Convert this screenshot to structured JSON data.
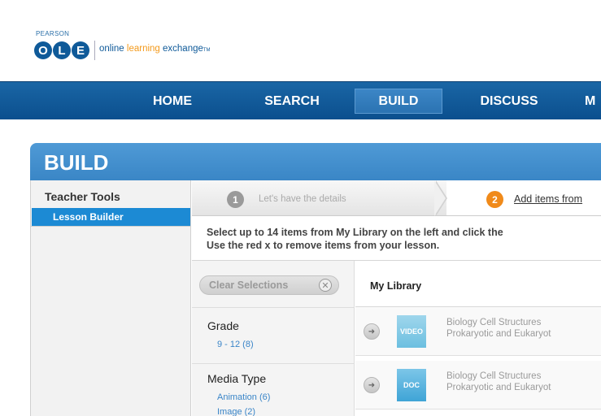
{
  "header": {
    "brand_small": "PEARSON",
    "logo_letters": [
      "O",
      "L",
      "E"
    ],
    "tagline_prefix": "online ",
    "tagline_highlight": "learning",
    "tagline_suffix": " exchange",
    "tagline_tm": "TM"
  },
  "nav": {
    "items": [
      {
        "label": "HOME"
      },
      {
        "label": "SEARCH"
      },
      {
        "label": "BUILD"
      },
      {
        "label": "DISCUSS"
      },
      {
        "label": "M"
      }
    ],
    "active_index": 2
  },
  "panel": {
    "title": "BUILD"
  },
  "sidebar": {
    "heading": "Teacher Tools",
    "items": [
      {
        "label": "Lesson Builder",
        "selected": true
      }
    ]
  },
  "steps": [
    {
      "number": "1",
      "label": "Let's have the details",
      "state": "done"
    },
    {
      "number": "2",
      "label": "Add items from",
      "state": "current"
    }
  ],
  "instructions": {
    "line1": "Select up to 14 items from My Library on the left and click the",
    "line2": "Use the red x to remove items from your lesson."
  },
  "filters": {
    "clear_label": "Clear Selections",
    "clear_icon": "close-icon",
    "grade": {
      "heading": "Grade",
      "options": [
        "9 - 12 (8)"
      ]
    },
    "media_type": {
      "heading": "Media Type",
      "options": [
        "Animation (6)",
        "Image (2)"
      ]
    }
  },
  "library": {
    "heading": "My Library",
    "items": [
      {
        "type": "VIDEO",
        "title_line1": "Biology Cell Structures",
        "title_line2": "Prokaryotic and Eukaryot"
      },
      {
        "type": "DOC",
        "title_line1": "Biology Cell Structures",
        "title_line2": "Prokaryotic and Eukaryot"
      }
    ]
  },
  "colors": {
    "nav_blue": "#0b4f8e",
    "panel_blue": "#3a86c6",
    "selected_blue": "#1c8ad4",
    "step_orange": "#f08a1a",
    "link_blue": "#3a85c8"
  }
}
